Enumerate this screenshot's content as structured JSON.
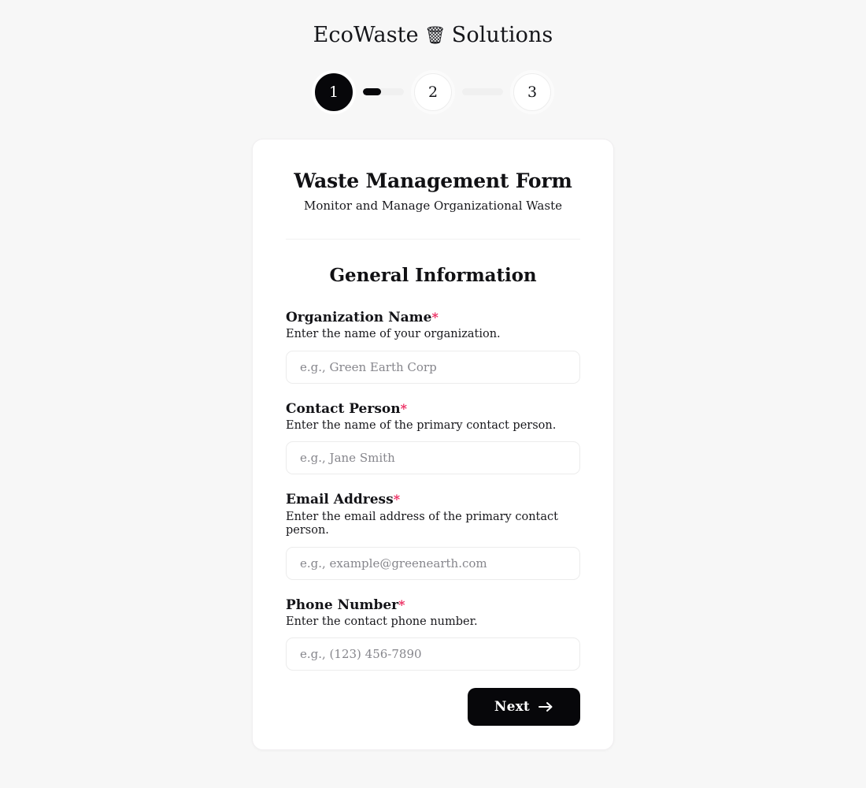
{
  "brand": {
    "name_before": "EcoWaste",
    "icon": "trash-bin-icon",
    "icon_glyph": "🗑",
    "name_after": "Solutions"
  },
  "stepper": {
    "current": 1,
    "steps": [
      {
        "label": "1",
        "state": "active"
      },
      {
        "label": "2",
        "state": "inactive"
      },
      {
        "label": "3",
        "state": "inactive"
      }
    ],
    "connectors": [
      {
        "fill_percent": 45
      },
      {
        "fill_percent": 0
      }
    ]
  },
  "card": {
    "title": "Waste Management Form",
    "subtitle": "Monitor and Manage Organizational Waste",
    "section_title": "General Information",
    "fields": [
      {
        "label": "Organization Name",
        "required_marker": "*",
        "description": "Enter the name of your organization.",
        "placeholder": "e.g., Green Earth Corp",
        "value": "",
        "name": "organization-name"
      },
      {
        "label": "Contact Person",
        "required_marker": "*",
        "description": "Enter the name of the primary contact person.",
        "placeholder": "e.g., Jane Smith",
        "value": "",
        "name": "contact-person"
      },
      {
        "label": "Email Address",
        "required_marker": "*",
        "description": "Enter the email address of the primary contact person.",
        "placeholder": "e.g., example@greenearth.com",
        "value": "",
        "name": "email-address"
      },
      {
        "label": "Phone Number",
        "required_marker": "*",
        "description": "Enter the contact phone number.",
        "placeholder": "e.g., (123) 456-7890",
        "value": "",
        "name": "phone-number"
      }
    ],
    "next_button": {
      "label": "Next",
      "icon": "arrow-right-icon",
      "icon_glyph": "→"
    }
  },
  "colors": {
    "page_background": "#f7f7f7",
    "card_background": "#ffffff",
    "accent_dark": "#07070a",
    "required_asterisk": "#ec2b60",
    "border": "#ececec",
    "placeholder": "#86868c"
  }
}
